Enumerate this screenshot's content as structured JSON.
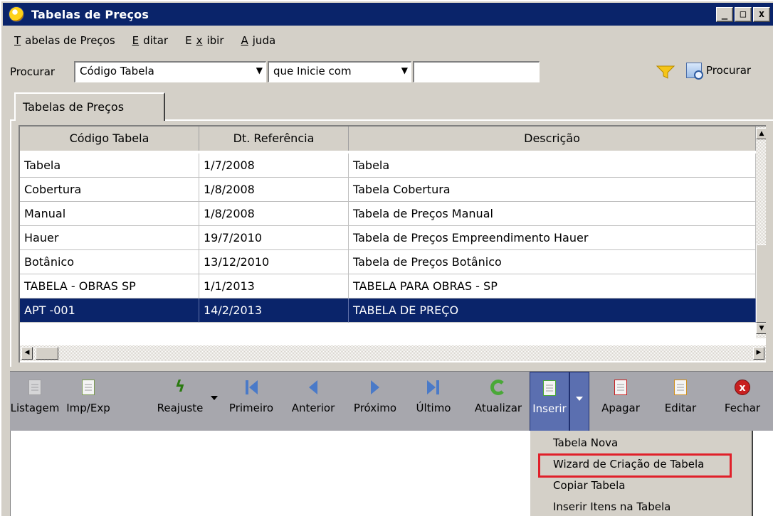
{
  "window": {
    "title": "Tabelas de Preços",
    "controls": [
      "_",
      "□",
      "x"
    ]
  },
  "menu": [
    {
      "label": "Tabelas de Preços",
      "accel": "T",
      "rest": "abelas de Preços"
    },
    {
      "label": "Editar",
      "accel": "E",
      "rest": "ditar"
    },
    {
      "label": "Exibir",
      "accel": "E",
      "rest": "xibir"
    },
    {
      "label": "Ajuda",
      "accel": "A",
      "rest": "juda"
    }
  ],
  "search": {
    "label": "Procurar",
    "field": "Código Tabela",
    "operator": "que Inicie com",
    "value": "",
    "button_label": "Procurar",
    "filter_icon": "funnel-icon",
    "search_icon": "search-icon"
  },
  "tab": {
    "label": "Tabelas de Preços"
  },
  "grid": {
    "columns": [
      "Código Tabela",
      "Dt. Referência",
      "Descrição"
    ],
    "rows": [
      [
        "Tabela",
        "1/7/2008",
        "Tabela"
      ],
      [
        "Cobertura",
        "1/8/2008",
        "Tabela Cobertura"
      ],
      [
        "Manual",
        "1/8/2008",
        "Tabela de Preços Manual"
      ],
      [
        "Hauer",
        "19/7/2010",
        "Tabela de Preços Empreendimento Hauer"
      ],
      [
        "Botânico",
        "13/12/2010",
        "Tabela de Preços Botânico"
      ],
      [
        "TABELA - OBRAS SP",
        "1/1/2013",
        "TABELA PARA OBRAS - SP"
      ],
      [
        "APT -001",
        "14/2/2013",
        "TABELA DE PREÇO"
      ]
    ],
    "selected_row": 6
  },
  "toolbar": {
    "listagem": "Listagem",
    "impexp": "Imp/Exp",
    "reajuste": "Reajuste",
    "primeiro": "Primeiro",
    "anterior": "Anterior",
    "proximo": "Próximo",
    "ultimo": "Último",
    "atualizar": "Atualizar",
    "inserir": "Inserir",
    "apagar": "Apagar",
    "editar": "Editar",
    "fechar": "Fechar"
  },
  "insert_menu": [
    "Tabela Nova",
    "Wizard de Criação de Tabela",
    "Copiar Tabela",
    "Inserir Itens na Tabela"
  ],
  "colors": {
    "titlebar": "#0a246a",
    "selection": "#0a246a",
    "highlight_box": "#e0202a",
    "toolbar": "#a7a7ad"
  }
}
